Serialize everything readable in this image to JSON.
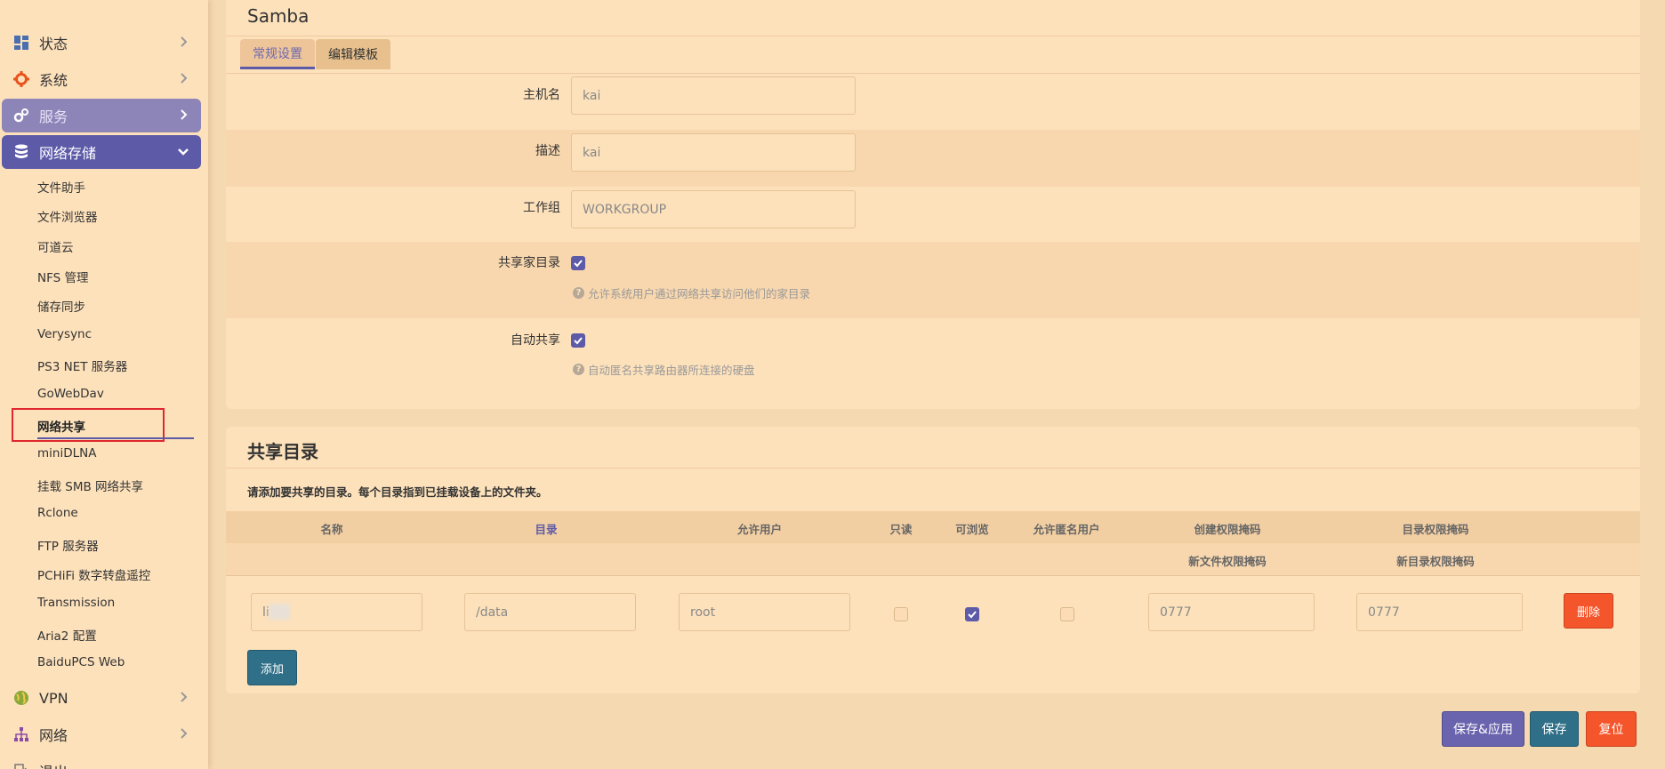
{
  "sidebar": {
    "nav": [
      {
        "label": "状态",
        "icon": "dashboard-icon"
      },
      {
        "label": "系统",
        "icon": "gear-icon"
      },
      {
        "label": "服务",
        "icon": "cogs-icon"
      },
      {
        "label": "网络存储",
        "icon": "database-icon"
      }
    ],
    "sub_items": [
      "文件助手",
      "文件浏览器",
      "可道云",
      "NFS 管理",
      "储存同步",
      "Verysync",
      "PS3 NET 服务器",
      "GoWebDav",
      "网络共享",
      "miniDLNA",
      "挂载 SMB 网络共享",
      "Rclone",
      "FTP 服务器",
      "PCHiFi 数字转盘遥控",
      "Transmission",
      "Aria2 配置",
      "BaiduPCS Web"
    ],
    "active_sub": "网络共享",
    "nav_bottom": [
      {
        "label": "VPN",
        "icon": "globe-icon"
      },
      {
        "label": "网络",
        "icon": "sitemap-icon"
      },
      {
        "label": "退出",
        "icon": "logout-icon"
      }
    ]
  },
  "samba": {
    "title": "Samba",
    "tabs": [
      "常规设置",
      "编辑模板"
    ],
    "fields": {
      "hostname": {
        "label": "主机名",
        "value": "kai"
      },
      "description": {
        "label": "描述",
        "value": "kai"
      },
      "workgroup": {
        "label": "工作组",
        "value": "WORKGROUP"
      }
    },
    "share_homes": {
      "label": "共享家目录",
      "checked": true,
      "hint": "允许系统用户通过网络共享访问他们的家目录"
    },
    "auto_share": {
      "label": "自动共享",
      "checked": true,
      "hint": "自动匿名共享路由器所连接的硬盘"
    }
  },
  "shares": {
    "title": "共享目录",
    "description": "请添加要共享的目录。每个目录指到已挂载设备上的文件夹。",
    "columns": [
      "名称",
      "目录",
      "允许用户",
      "只读",
      "可浏览",
      "允许匿名用户",
      "创建权限掩码",
      "目录权限掩码"
    ],
    "subcolumns": [
      "新文件权限掩码",
      "新目录权限掩码"
    ],
    "rows": [
      {
        "name": "li",
        "path": "/data",
        "users": "root",
        "readonly": false,
        "browseable": true,
        "guest": false,
        "create_mask": "0777",
        "dir_mask": "0777",
        "delete_label": "删除"
      }
    ],
    "add_label": "添加"
  },
  "actions": {
    "save_apply": "保存&应用",
    "save": "保存",
    "reset": "复位"
  },
  "colors": {
    "accent": "#5d5aa8",
    "danger": "#f4552a",
    "teal": "#2f6f88",
    "background": "#f5d9b1"
  }
}
